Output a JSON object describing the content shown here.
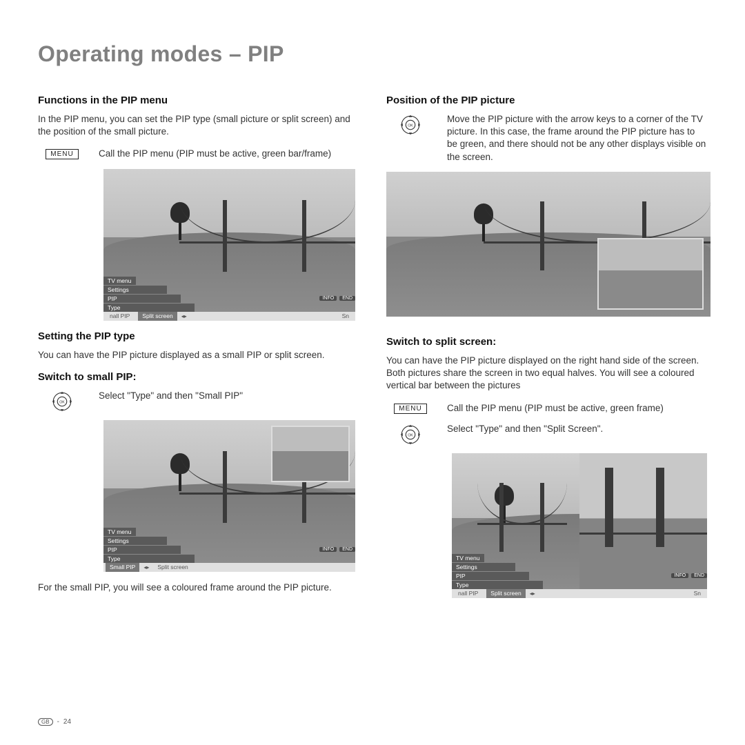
{
  "title": "Operating modes – PIP",
  "left": {
    "s1": {
      "heading": "Functions in the PIP menu",
      "para": "In the PIP menu, you can set the PIP type (small picture or split screen) and the position of the small picture.",
      "menu_label": "MENU",
      "menu_caption": "Call the PIP menu (PIP must be active, green bar/frame)"
    },
    "s2": {
      "heading": "Setting the PIP type",
      "para": "You can have the PIP picture displayed as a small PIP or split screen."
    },
    "s3": {
      "heading": "Switch to small PIP:",
      "ok_caption": "Select \"Type\" and then \"Small PIP\"",
      "after": "For the small PIP, you will see a coloured frame around the PIP picture."
    }
  },
  "right": {
    "s1": {
      "heading": "Position of the PIP picture",
      "ok_caption": "Move the PIP picture with the arrow keys to a corner of the TV picture. In this case, the frame around the PIP picture has to be green, and there should not be any other displays visible on the screen."
    },
    "s2": {
      "heading": "Switch to split screen:",
      "para": "You can have the PIP picture displayed on the right hand side of the screen. Both pictures share the screen in two equal halves. You will see a coloured vertical bar between the pictures",
      "menu_label": "MENU",
      "menu_caption": "Call the PIP menu (PIP must be active, green frame)",
      "ok_caption": "Select \"Type\" and then \"Split Screen\"."
    }
  },
  "osd": {
    "crumb1": "TV menu",
    "crumb2": "Settings",
    "crumb3": "PIP",
    "crumb4": "Type",
    "opt_small": "Small PIP",
    "opt_small_trunc": "nall PIP",
    "opt_split": "Split screen",
    "opt_split_trunc": "Sn",
    "tag_info": "INFO",
    "tag_end": "END"
  },
  "footer": {
    "region": "GB",
    "page": "24"
  }
}
